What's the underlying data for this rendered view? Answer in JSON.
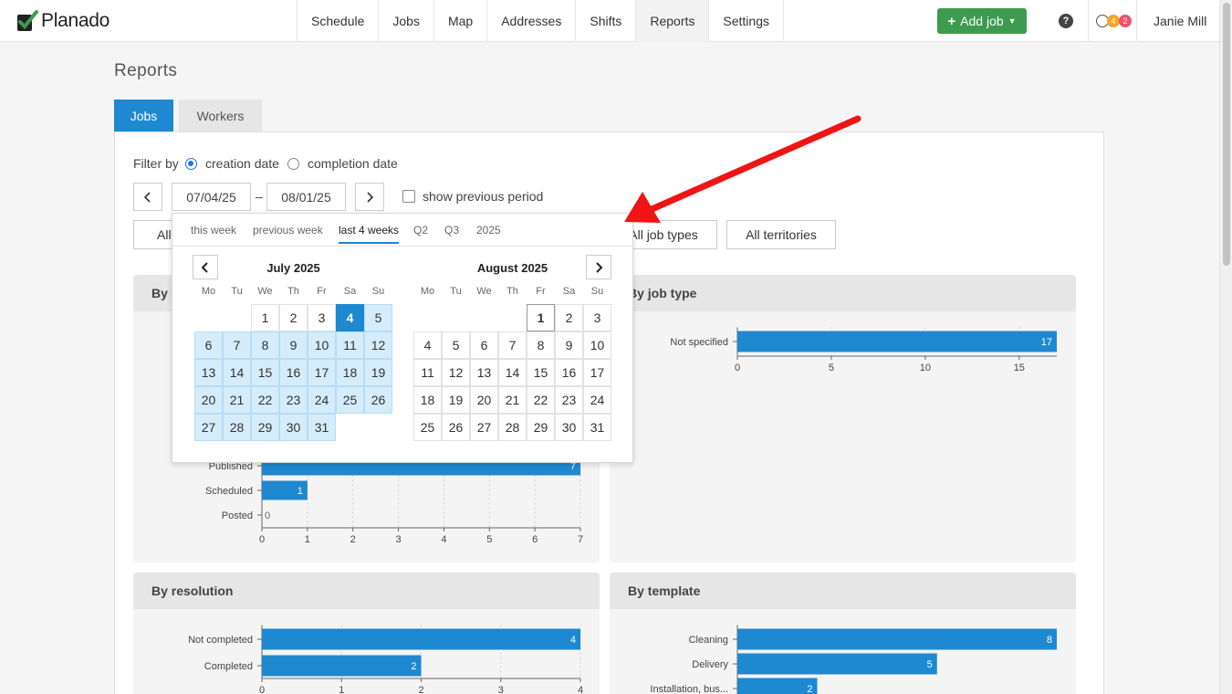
{
  "app": {
    "brand": "Planado"
  },
  "nav": {
    "items": [
      "Schedule",
      "Jobs",
      "Map",
      "Addresses",
      "Shifts",
      "Reports",
      "Settings"
    ],
    "active": "Reports"
  },
  "header": {
    "add_job": "Add job",
    "help": "?",
    "badge_orange": "4",
    "badge_red": "2",
    "user": "Janie Mill"
  },
  "page": {
    "title": "Reports"
  },
  "tabs": {
    "jobs": "Jobs",
    "workers": "Workers"
  },
  "filter": {
    "label": "Filter by",
    "creation": "creation date",
    "completion": "completion date",
    "from": "07/04/25",
    "to": "08/01/25",
    "dash": "–",
    "show_previous": "show previous period",
    "btn_all": "All",
    "btn_job_types": "All job types",
    "btn_territories": "All territories"
  },
  "datepicker": {
    "presets": [
      "this week",
      "previous week",
      "last 4 weeks",
      "Q2",
      "Q3",
      "2025"
    ],
    "active_preset": "last 4 weeks",
    "weekdays": [
      "Mo",
      "Tu",
      "We",
      "Th",
      "Fr",
      "Sa",
      "Su"
    ],
    "left_month": "July 2025",
    "right_month": "August 2025"
  },
  "cards": {
    "status_title": "By s",
    "job_type_title": "By job type",
    "resolution_title": "By resolution",
    "template_title": "By template"
  },
  "chart_data": [
    {
      "type": "bar",
      "orientation": "horizontal",
      "title": "By status",
      "categories": [
        "Published",
        "Scheduled",
        "Posted"
      ],
      "values": [
        7,
        1,
        0
      ],
      "xlim": [
        0,
        7
      ],
      "xticks": [
        0,
        1,
        2,
        3,
        4,
        5,
        6,
        7
      ]
    },
    {
      "type": "bar",
      "orientation": "horizontal",
      "title": "By job type",
      "categories": [
        "Not specified"
      ],
      "values": [
        17
      ],
      "xlim": [
        0,
        17
      ],
      "xticks": [
        0,
        5,
        10,
        15
      ]
    },
    {
      "type": "bar",
      "orientation": "horizontal",
      "title": "By resolution",
      "categories": [
        "Not completed",
        "Completed"
      ],
      "values": [
        4,
        2
      ],
      "xlim": [
        0,
        4
      ],
      "xticks": [
        0,
        1,
        2,
        3,
        4
      ]
    },
    {
      "type": "bar",
      "orientation": "horizontal",
      "title": "By template",
      "categories": [
        "Cleaning",
        "Delivery",
        "Installation, bus..."
      ],
      "values": [
        8,
        5,
        2
      ],
      "xlim": [
        0,
        8
      ]
    }
  ]
}
